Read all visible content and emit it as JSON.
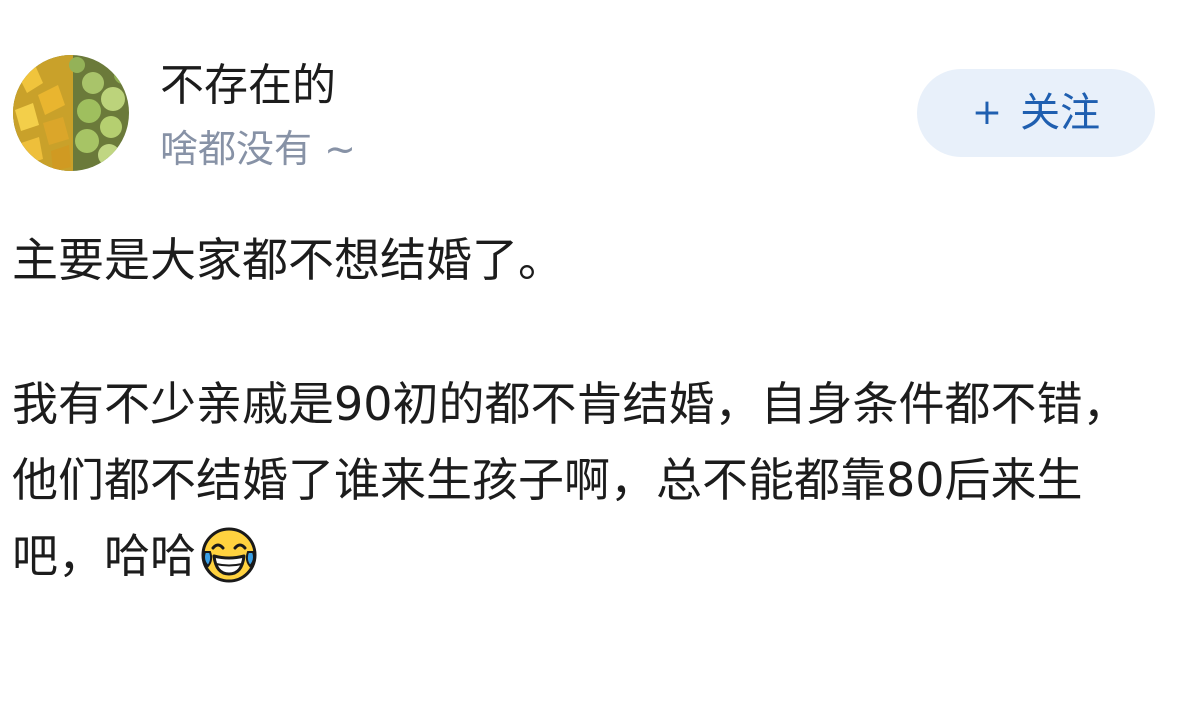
{
  "user": {
    "name": "不存在的",
    "bio": "啥都没有 ~",
    "avatar_icon": "fruit-photo-avatar"
  },
  "follow_button": {
    "icon": "+",
    "label": "关注",
    "color": "#1f5fb0",
    "background": "#e8f0fa"
  },
  "post": {
    "paragraph1": "主要是大家都不想结婚了。",
    "paragraph2": "我有不少亲戚是90初的都不肯结婚，自身条件都不错，他们都不结婚了谁来生孩子啊，总不能都靠80后来生吧，哈哈",
    "emoji": "laughing-with-tears-emoji"
  }
}
